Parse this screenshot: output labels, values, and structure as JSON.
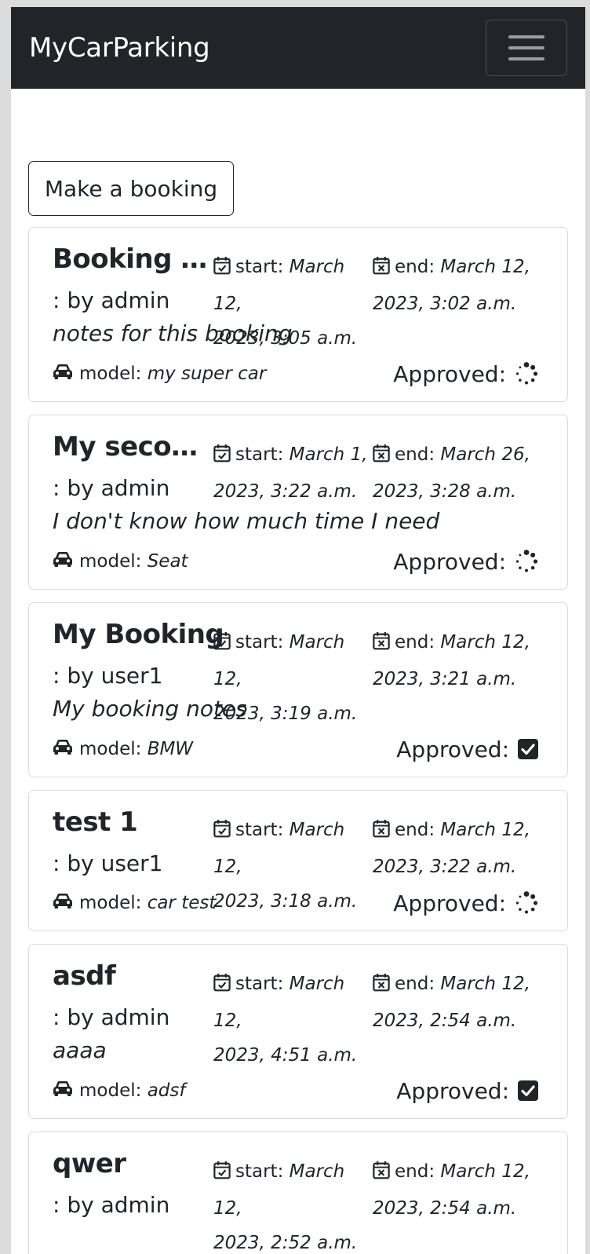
{
  "app": {
    "brand": "MyCarParking",
    "menu_icon": "hamburger-menu-icon"
  },
  "actions": {
    "make_booking_label": "Make a booking"
  },
  "labels": {
    "start": "start:",
    "end": "end:",
    "model": "model:",
    "approved": "Approved:"
  },
  "bookings": [
    {
      "title": "Booking i...",
      "by": ": by admin",
      "start_line1": "March 12,",
      "start_line2": "2023, 3:05 a.m.",
      "end_line1": "March 12,",
      "end_line2": "2023, 3:02 a.m.",
      "notes": "notes for this booking",
      "model": "my super car",
      "approved": false
    },
    {
      "title": "My secon...",
      "by": ": by admin",
      "start_line1": "March 1,",
      "start_line2": "2023, 3:22 a.m.",
      "end_line1": "March 26,",
      "end_line2": "2023, 3:28 a.m.",
      "notes": "I don't know how much time I need",
      "model": "Seat",
      "approved": false
    },
    {
      "title": "My Booking",
      "by": ": by user1",
      "start_line1": "March 12,",
      "start_line2": "2023, 3:19 a.m.",
      "end_line1": "March 12,",
      "end_line2": "2023, 3:21 a.m.",
      "notes": "My booking notes",
      "model": "BMW",
      "approved": true
    },
    {
      "title": "test 1",
      "by": ": by user1",
      "start_line1": "March 12,",
      "start_line2": "2023, 3:18 a.m.",
      "end_line1": "March 12,",
      "end_line2": "2023, 3:22 a.m.",
      "notes": "",
      "model": "car test",
      "approved": false
    },
    {
      "title": "asdf",
      "by": ": by admin",
      "start_line1": "March 12,",
      "start_line2": "2023, 4:51 a.m.",
      "end_line1": "March 12,",
      "end_line2": "2023, 2:54 a.m.",
      "notes": "aaaa",
      "model": "adsf",
      "approved": true
    },
    {
      "title": "qwer",
      "by": ": by admin",
      "start_line1": "March 12,",
      "start_line2": "2023, 2:52 a.m.",
      "end_line1": "March 12,",
      "end_line2": "2023, 2:54 a.m.",
      "notes": "",
      "model": "",
      "approved": false
    }
  ],
  "icons": {
    "start": "calendar-check-icon",
    "end": "calendar-x-icon",
    "car": "car-icon",
    "pending": "spinner-icon",
    "approved": "checkbox-checked-icon"
  },
  "colors": {
    "navbar": "#212529",
    "text": "#212529",
    "card_border": "#d9dcdf"
  }
}
